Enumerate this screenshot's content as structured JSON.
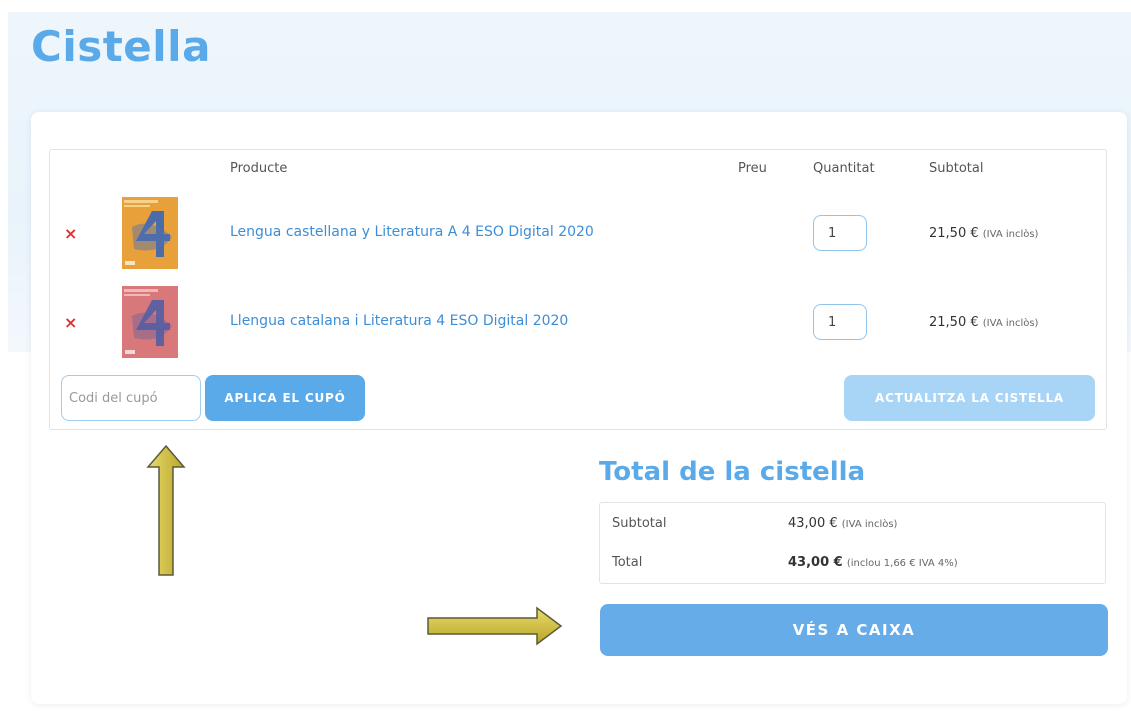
{
  "page": {
    "title": "Cistella"
  },
  "cart": {
    "headers": {
      "product": "Producte",
      "price": "Preu",
      "quantity": "Quantitat",
      "subtotal": "Subtotal"
    },
    "remove_symbol": "×",
    "items": [
      {
        "name": "Lengua castellana y Literatura A 4 ESO Digital 2020",
        "price": "",
        "quantity": "1",
        "subtotal": "21,50 €",
        "subtotal_note": "(IVA inclòs)",
        "cover_color": "#e8a03a"
      },
      {
        "name": "Llengua catalana i Literatura 4 ESO Digital 2020",
        "price": "",
        "quantity": "1",
        "subtotal": "21,50 €",
        "subtotal_note": "(IVA inclòs)",
        "cover_color": "#d9787a"
      }
    ],
    "coupon": {
      "placeholder": "Codi del cupó",
      "value": ""
    },
    "apply_coupon_label": "Aplica el cupó",
    "update_cart_label": "Actualitza la cistella"
  },
  "totals": {
    "title": "Total de la cistella",
    "subtotal_label": "Subtotal",
    "subtotal_value": "43,00 €",
    "subtotal_note": "(IVA inclòs)",
    "total_label": "Total",
    "total_value": "43,00 €",
    "total_note": "(inclou 1,66 € IVA 4%)",
    "checkout_label": "Vés a caixa"
  },
  "colors": {
    "accent": "#5aa9e8",
    "link": "#3d8ed6",
    "remove": "#e03131",
    "annotation_arrow": "#d8c640"
  }
}
